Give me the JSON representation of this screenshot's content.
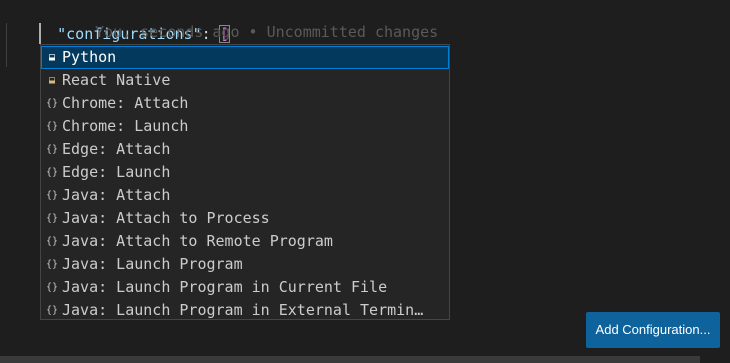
{
  "editor": {
    "line1": {
      "key": "\"configurations\"",
      "colon": ": ",
      "open_bracket": "["
    },
    "ghost_text": "You, seconds ago • Uncommitted changes",
    "close_bracket": "]",
    "close_brace": "}"
  },
  "suggestions": {
    "selected_index": 0,
    "items": [
      {
        "label": "Python",
        "icon": "snippet-icon"
      },
      {
        "label": "React Native",
        "icon": "snippet-icon"
      },
      {
        "label": "Chrome: Attach",
        "icon": "braces-icon"
      },
      {
        "label": "Chrome: Launch",
        "icon": "braces-icon"
      },
      {
        "label": "Edge: Attach",
        "icon": "braces-icon"
      },
      {
        "label": "Edge: Launch",
        "icon": "braces-icon"
      },
      {
        "label": "Java: Attach",
        "icon": "braces-icon"
      },
      {
        "label": "Java: Attach to Process",
        "icon": "braces-icon"
      },
      {
        "label": "Java: Attach to Remote Program",
        "icon": "braces-icon"
      },
      {
        "label": "Java: Launch Program",
        "icon": "braces-icon"
      },
      {
        "label": "Java: Launch Program in Current File",
        "icon": "braces-icon"
      },
      {
        "label": "Java: Launch Program in External Termin…",
        "icon": "braces-icon"
      }
    ]
  },
  "buttons": {
    "add_configuration": "Add Configuration..."
  },
  "colors": {
    "background": "#1e1e1e",
    "selection": "#04395e",
    "selection_border": "#007fd4",
    "button": "#0e639c"
  }
}
